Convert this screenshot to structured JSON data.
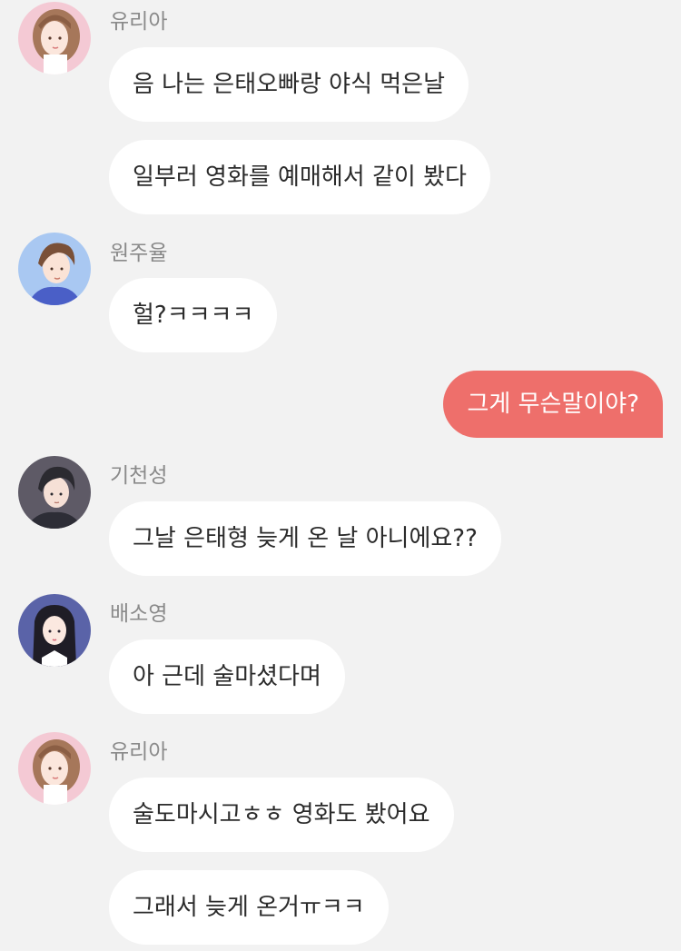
{
  "colors": {
    "background": "#f2f2f2",
    "incoming_bubble": "#ffffff",
    "outgoing_bubble": "#ee6f6b",
    "sender_name": "#8a8a8a",
    "message_text": "#2b2b2b"
  },
  "messages": [
    {
      "sender": "유리아",
      "avatar": "yuria-avatar",
      "lines": [
        "음 나는 은태오빠랑 야식 먹은날",
        "일부러 영화를 예매해서 같이 봤다"
      ]
    },
    {
      "sender": "원주율",
      "avatar": "wonjuyul-avatar",
      "lines": [
        "헐?ㅋㅋㅋㅋ"
      ]
    },
    {
      "sender": "me",
      "lines": [
        "그게 무슨말이야?"
      ]
    },
    {
      "sender": "기천성",
      "avatar": "gicheonseong-avatar",
      "lines": [
        "그날 은태형 늦게 온 날 아니에요??"
      ]
    },
    {
      "sender": "배소영",
      "avatar": "baesoyoung-avatar",
      "lines": [
        "아 근데 술마셨다며"
      ]
    },
    {
      "sender": "유리아",
      "avatar": "yuria-avatar",
      "lines": [
        "술도마시고ㅎㅎ 영화도 봤어요",
        "그래서 늦게 온거ㅠㅋㅋ"
      ]
    }
  ]
}
